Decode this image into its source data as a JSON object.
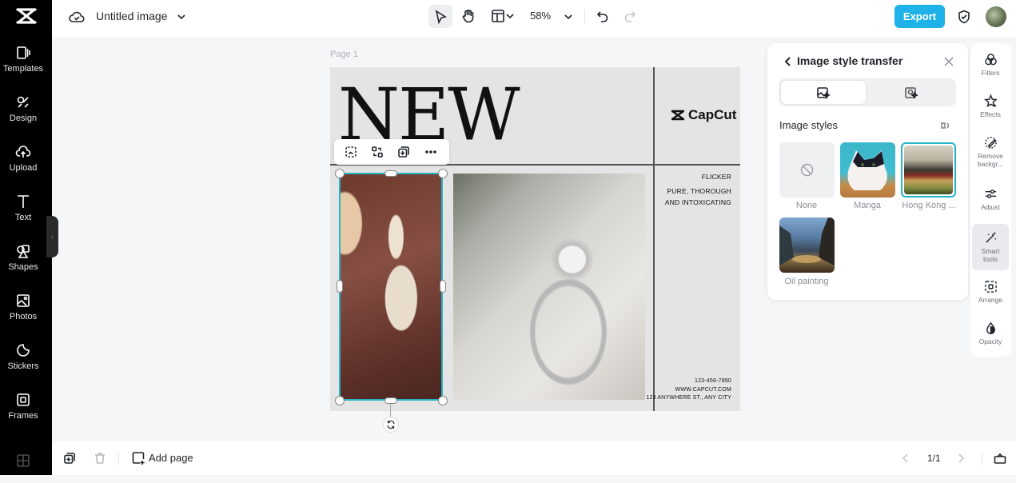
{
  "app": {
    "title": "Untitled image",
    "zoom": "58%",
    "export_label": "Export"
  },
  "sidebar": {
    "items": [
      {
        "label": "Templates",
        "icon": "templates-icon"
      },
      {
        "label": "Design",
        "icon": "design-icon"
      },
      {
        "label": "Upload",
        "icon": "upload-icon"
      },
      {
        "label": "Text",
        "icon": "text-icon"
      },
      {
        "label": "Shapes",
        "icon": "shapes-icon"
      },
      {
        "label": "Photos",
        "icon": "photos-icon"
      },
      {
        "label": "Stickers",
        "icon": "stickers-icon"
      },
      {
        "label": "Frames",
        "icon": "frames-icon"
      }
    ]
  },
  "canvas": {
    "page_label": "Page 1",
    "headline": "NEW",
    "brand": "CapCut",
    "tagline": [
      "FLICKER",
      "PURE, THOROUGH",
      "AND INTOXICATING"
    ],
    "contact": [
      "123-456-7890",
      "WWW.CAPCUT.COM",
      "123 ANYWHERE ST., ANY CITY"
    ]
  },
  "panel": {
    "title": "Image style transfer",
    "section_label": "Image styles",
    "styles": [
      {
        "label": "None",
        "selected": false
      },
      {
        "label": "Manga",
        "selected": false
      },
      {
        "label": "Hong Kong ...",
        "selected": true
      },
      {
        "label": "Oil painting",
        "selected": false
      }
    ],
    "accent": "#25b4c8"
  },
  "right_toolbar": {
    "items": [
      {
        "label": "Filters"
      },
      {
        "label": "Effects"
      },
      {
        "label": "Remove backgr..."
      },
      {
        "label": "Adjust"
      },
      {
        "label": "Smart tools",
        "active": true
      },
      {
        "label": "Arrange"
      },
      {
        "label": "Opacity"
      }
    ]
  },
  "bottom": {
    "add_page_label": "Add page",
    "page_indicator": "1/1"
  }
}
